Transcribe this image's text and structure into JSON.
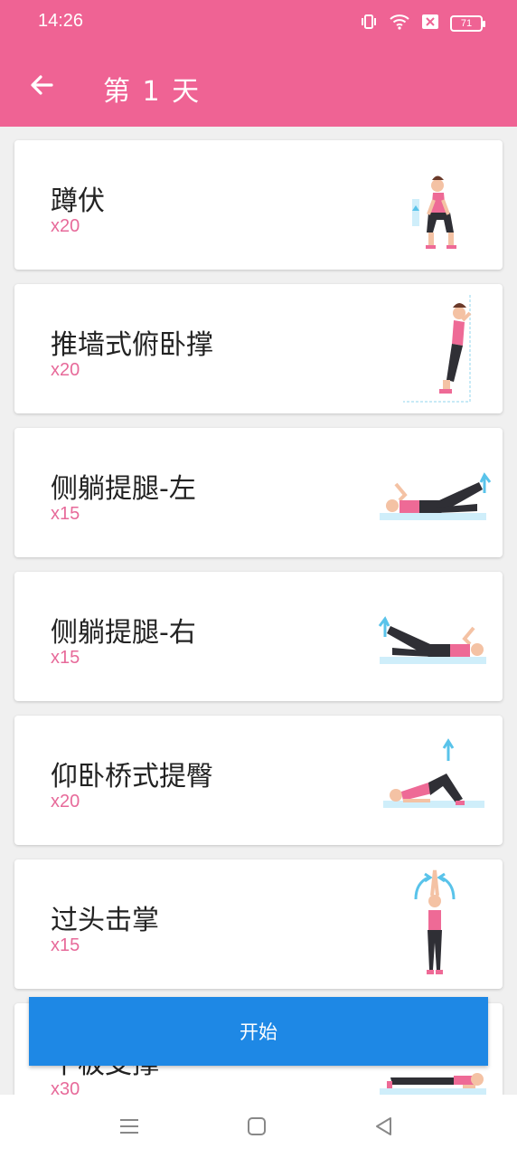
{
  "status": {
    "time": "14:26",
    "battery": "71"
  },
  "appbar": {
    "title": "第 1 天"
  },
  "exercises": [
    {
      "name": "蹲伏",
      "count": "x20"
    },
    {
      "name": "推墙式俯卧撑",
      "count": "x20"
    },
    {
      "name": "侧躺提腿-左",
      "count": "x15"
    },
    {
      "name": "侧躺提腿-右",
      "count": "x15"
    },
    {
      "name": "仰卧桥式提臀",
      "count": "x20"
    },
    {
      "name": "过头击掌",
      "count": "x15"
    },
    {
      "name": "平板支撑",
      "count": "x30"
    }
  ],
  "start_button": {
    "label": "开始"
  },
  "colors": {
    "primary": "#ef6394",
    "accent_count": "#e76a9a",
    "button": "#1e88e5"
  }
}
